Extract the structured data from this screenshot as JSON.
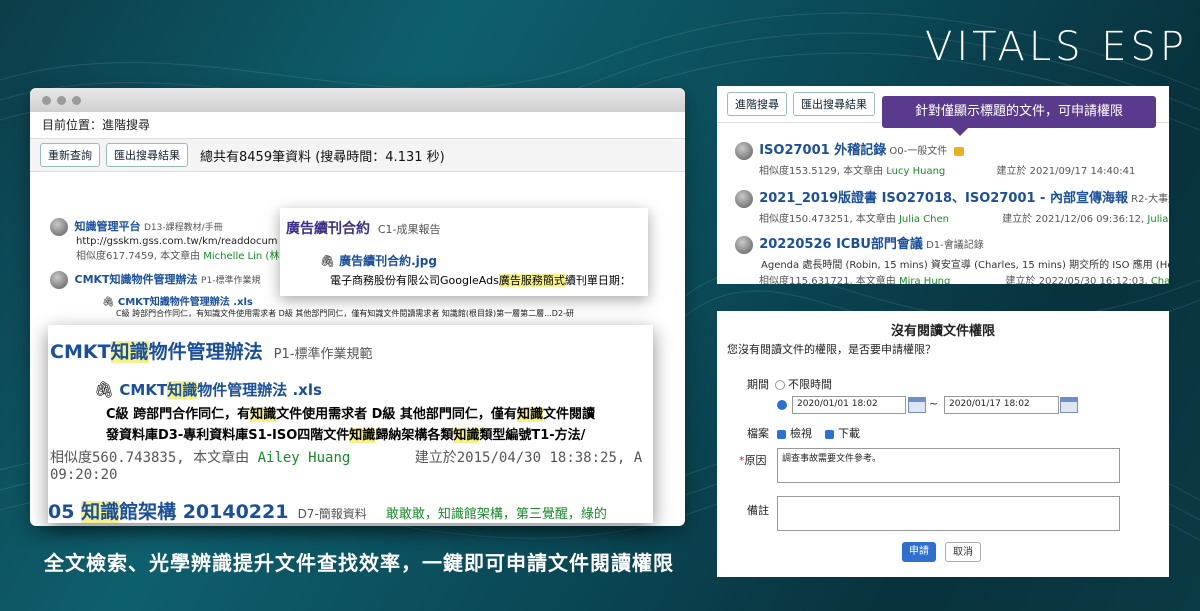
{
  "brand": {
    "logo_text": "VITALS ESP"
  },
  "caption": "全文檢索、光學辨識提升文件查找效率，一鍵即可申請文件閱讀權限",
  "search_window": {
    "breadcrumb": "目前位置：進階搜尋",
    "toolbar": {
      "requery_label": "重新查詢",
      "export_label": "匯出搜尋結果"
    },
    "total_text": "總共有8459筆資料 (搜尋時間：4.131 秒)",
    "results": [
      {
        "title": "知識管理平台",
        "category": "D13-課程教材/手冊",
        "url": "http://gsskm.gss.com.tw/km/readdocum",
        "meta": "相似度617.7459, 本文章由",
        "author": "Michelle Lin (林"
      },
      {
        "title": "CMKT知識物件管理辦法",
        "category": "P1-標準作業規",
        "file": "CMKT知識物件管理辦法 .xls",
        "snippet": "C級 跨部門合作同仁，有知識文件使用需求者 D級 其他部門同仁，僅有知識文件閱讀需求者 知識館(根目錄)第一層第二層...D2-研"
      }
    ]
  },
  "popover_contract": {
    "title": "廣告續刊合約",
    "category": "C1-成果報告",
    "file": "廣告續刊合約.jpg",
    "snippet_pre": "電子商務股份有限公司GoogleAds",
    "snippet_hl": "廣告服務簡式",
    "snippet_post": "續刊單日期："
  },
  "zoom_card": {
    "title_pre": "CMKT",
    "title_hl": "知識",
    "title_post": "物件管理辦法",
    "category": "P1-標準作業規範",
    "file_pre": "CMKT",
    "file_hl": "知識",
    "file_post": "物件管理辦法 .xls",
    "line1_a": "C級 跨部門合作同仁，有",
    "line1_hl1": "知識",
    "line1_b": "文件使用需求者 D級 其他部門同仁，僅有",
    "line1_hl2": "知識",
    "line1_c": "文件閱讀",
    "line2_a": "發資料庫D3-專利資料庫S1-ISO四階文件",
    "line2_hl1": "知識",
    "line2_b": "歸納架構各類",
    "line2_hl2": "知識",
    "line2_c": "類型編號T1-方法/",
    "meta": "相似度560.743835, 本文章由",
    "author": "Ailey Huang",
    "created": "建立於2015/04/30 18:38:25, A",
    "time2": "09:20:20",
    "next_title_pre": "05 ",
    "next_title_hl": "知識",
    "next_title_post": "館架構 20140221",
    "next_category": "D7-簡報資料",
    "next_green": "敢敢敢，知識館架構，第三覺醒，綠的"
  },
  "right_panel": {
    "toolbar": {
      "requery_label": "進階搜尋",
      "export_label": "匯出搜尋結果"
    },
    "tooltip": "針對僅顯示標題的文件，可申請權限",
    "items": [
      {
        "title": "ISO27001 外稽記錄",
        "category": "O0-一般文件",
        "meta": "相似度153.5129, 本文章由",
        "author": "Lucy Huang",
        "created": "建立於 2021/09/17 14:40:41"
      },
      {
        "title": "2021_2019版證書 ISO27018、ISO27001 - 內部宣傳海報",
        "category": "R2-大事紀/",
        "meta": "相似度150.473251, 本文章由",
        "author": "Julia Chen",
        "created": "建立於 2021/12/06 09:36:12,",
        "author2": "Julia C"
      },
      {
        "title": "20220526 ICBU部門會議",
        "category": "D1-會議記錄",
        "snippet": "Agenda 處長時間 (Robin, 15 mins) 資安宣導 (Charles, 15 mins) 期交所的 ISO 應用 (He",
        "meta": "相似度115.631721, 本文章由",
        "author": "Mira Hung",
        "created": "建立於 2022/05/30 16:12:03,",
        "author2": "Charl"
      }
    ]
  },
  "request_dialog": {
    "title": "沒有閱讀文件權限",
    "question": "您沒有閱讀文件的權限，是否要申請權限？",
    "period_label": "期間",
    "unlimited_label": "不限時間",
    "date_from": "2020/01/01 18:02",
    "date_to": "2020/01/17 18:02",
    "range_sep": "~",
    "file_label": "檔案",
    "view_label": "檢視",
    "download_label": "下載",
    "reason_required": "*",
    "reason_label": "原因",
    "reason_value": "調查事故需要文件參考。",
    "note_label": "備註",
    "apply_label": "申請",
    "cancel_label": "取消"
  },
  "colors": {
    "accent": "#2f6fd0",
    "tooltip": "#5a3a8c",
    "highlight": "#f6f08a",
    "author_green": "#1a8a2a",
    "title_blue": "#1a4f9c"
  }
}
